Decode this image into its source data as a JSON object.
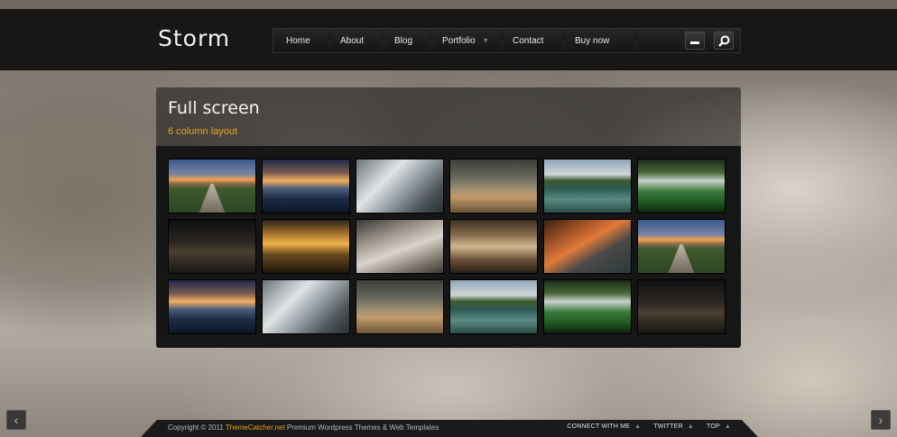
{
  "header": {
    "logo": "Storm",
    "nav": [
      {
        "label": "Home"
      },
      {
        "label": "About"
      },
      {
        "label": "Blog"
      },
      {
        "label": "Portfolio",
        "caret": "▼"
      },
      {
        "label": "Contact"
      },
      {
        "label": "Buy now"
      }
    ],
    "minimize_icon": "minus-icon",
    "search_icon": "search-icon"
  },
  "panel": {
    "title": "Full screen",
    "subtitle": "6 column layout",
    "accent_color": "#e9a21c",
    "thumbnails": [
      "pier",
      "sea",
      "stream",
      "dune",
      "island",
      "falls",
      "night",
      "gold",
      "rocks",
      "hall",
      "ruin",
      "pier",
      "sea",
      "stream",
      "dune",
      "island",
      "falls",
      "dark"
    ]
  },
  "footer": {
    "copyright_prefix": "Copyright © 2011 ",
    "brand": "ThemeCatcher.net",
    "copyright_suffix": " Premium Wordpress Themes & Web Templates",
    "links": [
      {
        "label": "CONNECT WITH ME"
      },
      {
        "label": "TWITTER"
      },
      {
        "label": "TOP"
      }
    ]
  },
  "arrows": {
    "prev": "‹",
    "next": "›"
  }
}
